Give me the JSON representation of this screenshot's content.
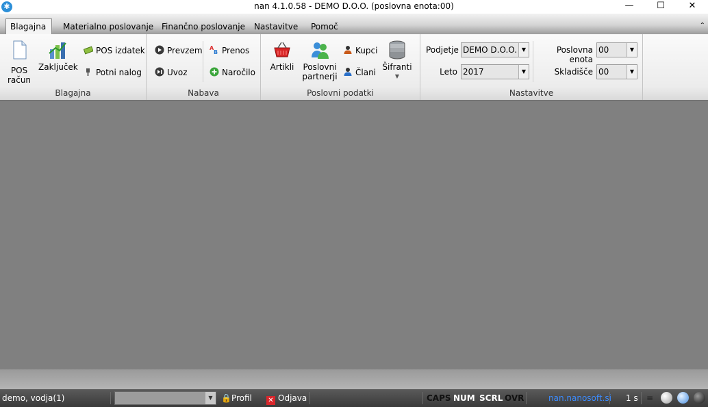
{
  "window": {
    "title": "nan 4.1.0.58 - DEMO D.O.O. (poslovna enota:00)",
    "controls": {
      "minimize": "—",
      "maximize": "☐",
      "close": "✕"
    }
  },
  "tabs": [
    {
      "label": "Blagajna",
      "active": true
    },
    {
      "label": "Materialno poslovanje"
    },
    {
      "label": "Finančno poslovanje"
    },
    {
      "label": "Nastavitve"
    },
    {
      "label": "Pomoč"
    }
  ],
  "ribbon": {
    "blagajna": {
      "label": "Blagajna",
      "pos_racun": "POS\nračun",
      "zakljucek": "Zaključek",
      "pos_izdatek": "POS izdatek",
      "potni_nalog": "Potni nalog"
    },
    "nabava": {
      "label": "Nabava",
      "prevzem": "Prevzem",
      "uvoz": "Uvoz",
      "prenos": "Prenos",
      "narocilo": "Naročilo"
    },
    "poslovni_podatki": {
      "label": "Poslovni podatki",
      "artikli": "Artikli",
      "poslovni_partnerji": "Poslovni\npartnerji",
      "kupci": "Kupci",
      "clani": "Člani",
      "sifranti": "Šifranti"
    },
    "nastavitve": {
      "label": "Nastavitve",
      "podjetje_label": "Podjetje",
      "podjetje_value": "DEMO D.O.O.",
      "leto_label": "Leto",
      "leto_value": "2017",
      "poslovna_enota_label": "Poslovna enota",
      "poslovna_enota_value": "00",
      "skladisce_label": "Skladišče",
      "skladisce_value": "00"
    }
  },
  "statusbar": {
    "user": "demo, vodja(1)",
    "search_value": "",
    "profil": "Profil",
    "odjava": "Odjava",
    "caps": "CAPS",
    "num": "NUM",
    "scrl": "SCRL",
    "ovr": "OVR",
    "link": "nan.nanosoft.si",
    "timer": "1 s"
  },
  "colors": {
    "accent_link": "#3c8cff",
    "close_red": "#d9262b",
    "workspace": "#808080"
  }
}
